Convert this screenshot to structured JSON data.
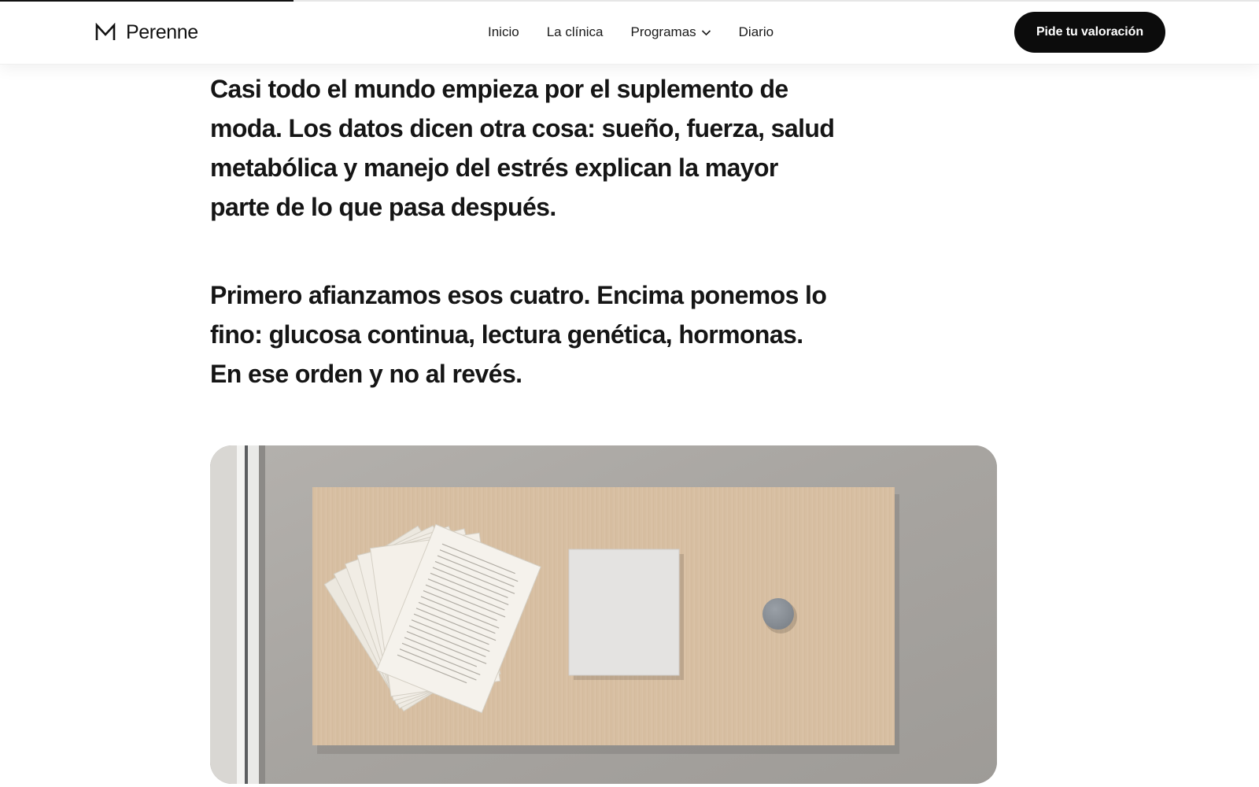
{
  "reading_progress": 0.233,
  "header": {
    "logo": {
      "mark_icon": "m-monogram-icon",
      "name": "Perenne"
    },
    "nav": [
      {
        "label": "Inicio"
      },
      {
        "label": "La clínica"
      },
      {
        "label": "Programas",
        "icon": "chevron-down-icon"
      },
      {
        "label": "Diario"
      }
    ],
    "cta_label": "Pide tu valoración"
  },
  "article": {
    "paragraphs": [
      "Casi todo el mundo empieza por el suplemento de moda. Los datos dicen otra cosa: sueño, fuerza, salud metabólica y manejo del estrés explican la mayor parte de lo que pasa después.",
      "Primero afianzamos esos cuatro. Encima ponemos lo fino: glucosa continua, lectura genética, hormonas. En ese orden y no al revés."
    ]
  },
  "colors": {
    "ink": "#141414",
    "button_bg": "#0c0c0c",
    "button_text": "#ffffff",
    "background": "#ffffff"
  }
}
